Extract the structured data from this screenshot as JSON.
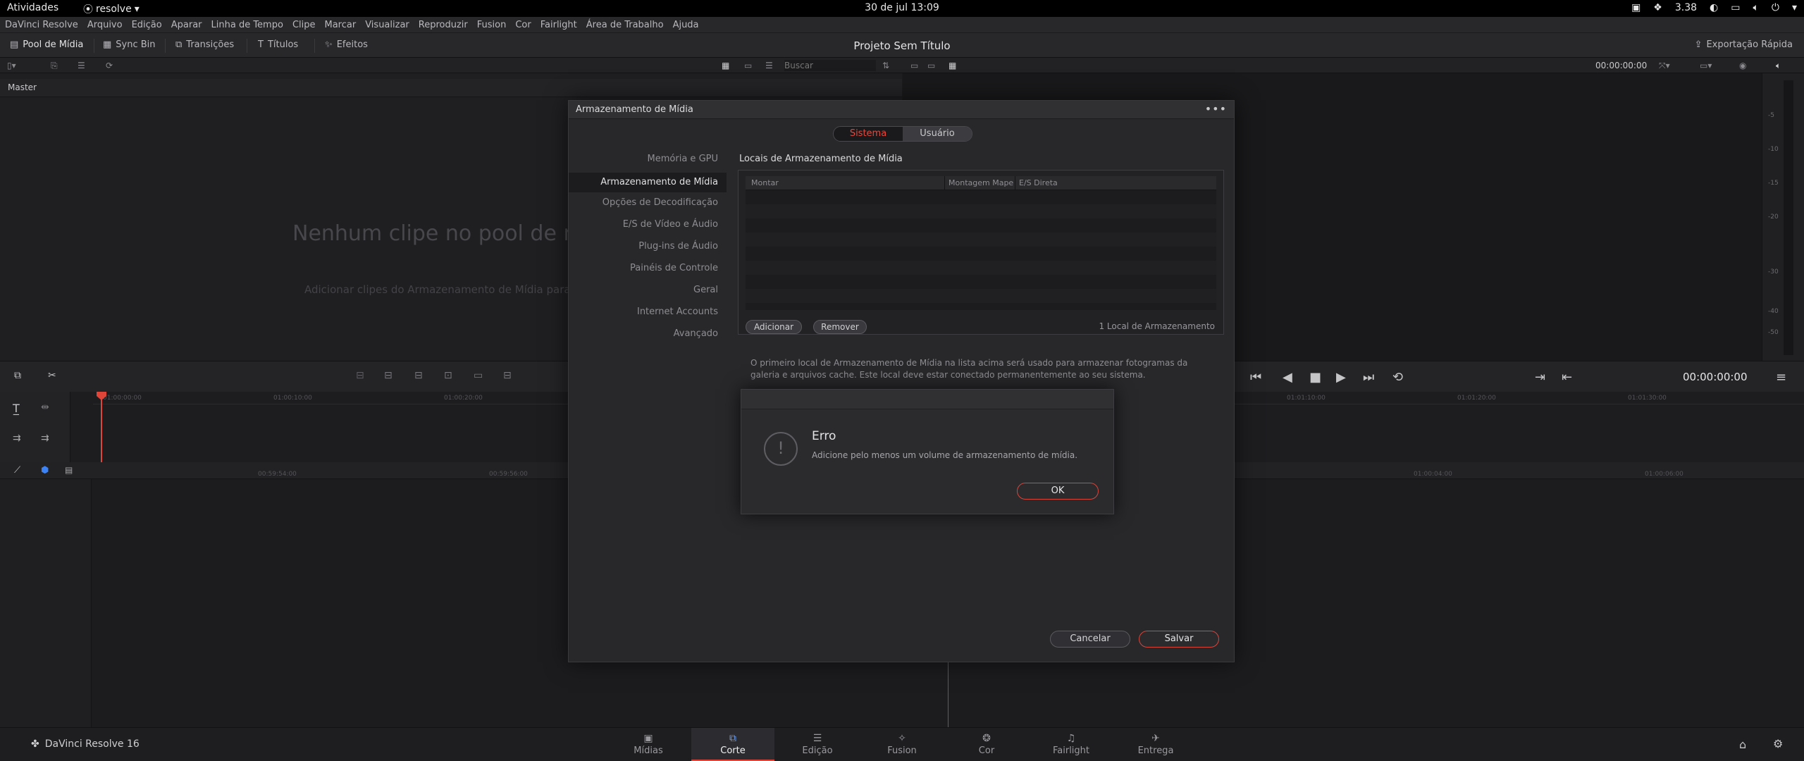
{
  "system_bar": {
    "activities": "Atividades",
    "app_name": "resolve",
    "clock": "30 de jul  13:09",
    "cpu": "3.38"
  },
  "menu": [
    "DaVinci Resolve",
    "Arquivo",
    "Edição",
    "Aparar",
    "Linha de Tempo",
    "Clipe",
    "Marcar",
    "Visualizar",
    "Reproduzir",
    "Fusion",
    "Cor",
    "Fairlight",
    "Área de Trabalho",
    "Ajuda"
  ],
  "toolbar": {
    "media_pool": "Pool de Mídia",
    "sync_bin": "Sync Bin",
    "transitions": "Transições",
    "titles": "Títulos",
    "effects": "Efeitos",
    "project_title": "Projeto Sem Título",
    "quick_export": "Exportação Rápida"
  },
  "subbar": {
    "search_placeholder": "Buscar",
    "viewer_timecode": "00:00:00:00"
  },
  "media_pool": {
    "bin": "Master",
    "empty_title": "Nenhum clipe no pool de mí",
    "empty_sub": "Adicionar clipes do Armazenamento de Mídia para co"
  },
  "meter_labels": [
    "-5",
    "-10",
    "-15",
    "-20",
    "-30",
    "-40",
    "-50"
  ],
  "transport": {
    "timecode": "00:00:00:00"
  },
  "timeline": {
    "ruler_top": [
      "01:00:00:00",
      "01:00:10:00",
      "01:00:20:00",
      "01:01:10:00",
      "01:01:20:00",
      "01:01:30:00"
    ],
    "ruler_bottom": [
      "00:59:54:00",
      "00:59:56:00",
      "01:00:04:00",
      "01:00:06:00"
    ]
  },
  "prefs": {
    "title": "Armazenamento de Mídia",
    "tab_system": "Sistema",
    "tab_user": "Usuário",
    "nav": [
      "Memória e GPU",
      "Armazenamento de Mídia",
      "Opções de Decodificação",
      "E/S de Vídeo e Áudio",
      "Plug-ins de Áudio",
      "Painéis de Controle",
      "Geral",
      "Internet Accounts",
      "Avançado"
    ],
    "section_title": "Locais de Armazenamento de Mídia",
    "col_mount": "Montar",
    "col_map": "Montagem Mape",
    "col_direct": "E/S Direta",
    "add": "Adicionar",
    "remove": "Remover",
    "count": "1 Local de Armazenamento",
    "description": "O primeiro local de Armazenamento de Mídia na lista acima será usado para armazenar fotogramas da galeria e arquivos cache. Este local deve estar conectado permanentemente ao seu sistema.",
    "cancel": "Cancelar",
    "save": "Salvar"
  },
  "error": {
    "title": "Erro",
    "message": "Adicione pelo menos um volume de armazenamento de mídia.",
    "ok": "OK"
  },
  "pages": {
    "brand": "DaVinci Resolve 16",
    "tabs": [
      "Mídias",
      "Corte",
      "Edição",
      "Fusion",
      "Cor",
      "Fairlight",
      "Entrega"
    ]
  }
}
